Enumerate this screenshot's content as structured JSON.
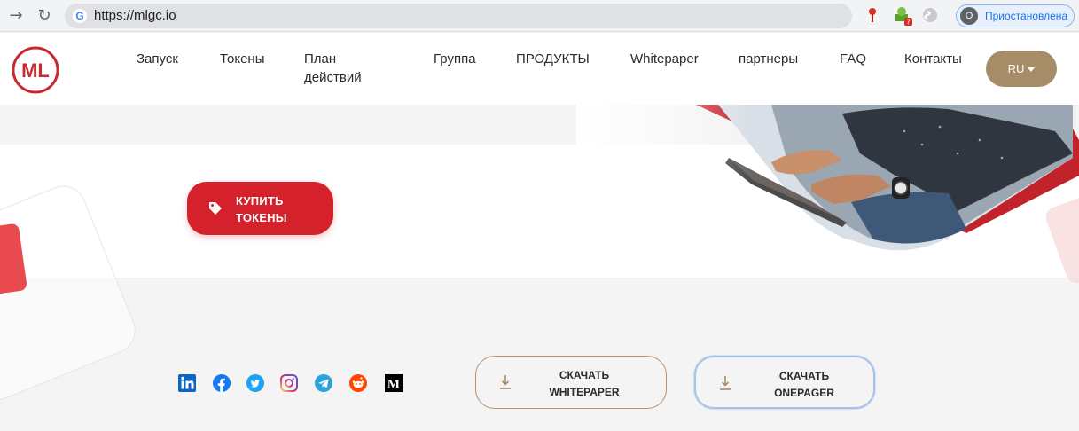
{
  "browser": {
    "url": "https://mlgc.io",
    "profile_initial": "O",
    "profile_label": "Приостановлена"
  },
  "header": {
    "logo_text": "ML",
    "nav": [
      {
        "label": "Запуск"
      },
      {
        "label": "Токены"
      },
      {
        "label": "План действий"
      },
      {
        "label": "Группа"
      },
      {
        "label": "ПРОДУКТЫ"
      },
      {
        "label": "Whitepaper"
      },
      {
        "label": "партнеры"
      },
      {
        "label": "FAQ"
      },
      {
        "label": "Контакты"
      }
    ],
    "lang_label": "RU"
  },
  "hero": {
    "buy_label": "КУПИТЬ ТОКЕНЫ"
  },
  "footer": {
    "social_icons": [
      "linkedin-icon",
      "facebook-icon",
      "twitter-icon",
      "instagram-icon",
      "telegram-icon",
      "reddit-icon",
      "medium-icon"
    ],
    "download_whitepaper": "СКАЧАТЬ WHITEPAPER",
    "download_onepager": "СКАЧАТЬ ONEPAGER"
  },
  "colors": {
    "brand_red": "#d4212b",
    "accent_gold": "#a68c67",
    "outline_gold": "#b49370"
  }
}
